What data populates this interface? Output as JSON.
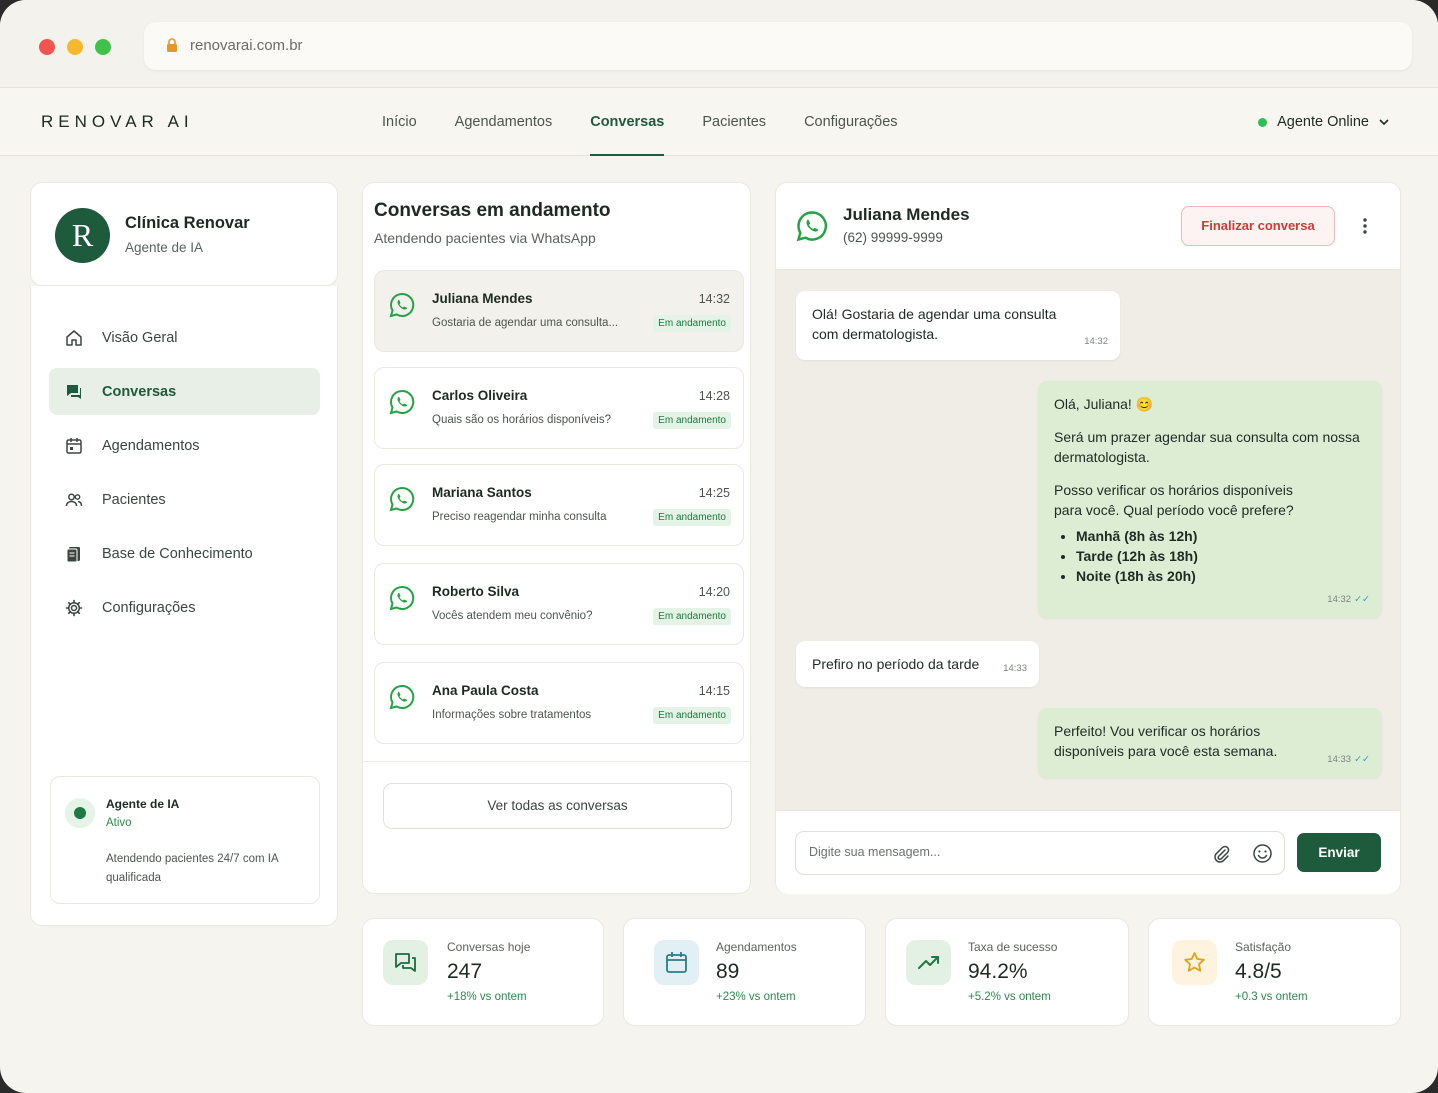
{
  "browser": {
    "url": "renovarai.com.br"
  },
  "header": {
    "logo": "RENOVAR AI",
    "nav": [
      "Início",
      "Agendamentos",
      "Conversas",
      "Pacientes",
      "Configurações"
    ],
    "active_nav": "Conversas",
    "agent_status": "Agente Online"
  },
  "sidebar": {
    "clinic_initial": "R",
    "clinic_name": "Clínica Renovar",
    "clinic_sub": "Agente de IA",
    "items": [
      {
        "label": "Visão Geral",
        "icon": "home-icon"
      },
      {
        "label": "Conversas",
        "icon": "chat-icon",
        "active": true
      },
      {
        "label": "Agendamentos",
        "icon": "calendar-icon"
      },
      {
        "label": "Pacientes",
        "icon": "users-icon"
      },
      {
        "label": "Base de Conhecimento",
        "icon": "book-icon"
      },
      {
        "label": "Configurações",
        "icon": "gear-icon"
      }
    ],
    "agent_box": {
      "title": "Agente de IA",
      "state": "Ativo",
      "desc": "Atendendo pacientes 24/7 com IA qualificada"
    }
  },
  "conversations": {
    "title": "Conversas em andamento",
    "subtitle": "Atendendo pacientes via WhatsApp",
    "items": [
      {
        "name": "Juliana Mendes",
        "time": "14:32",
        "preview": "Gostaria de agendar uma consulta...",
        "badge": "Em andamento"
      },
      {
        "name": "Carlos Oliveira",
        "time": "14:28",
        "preview": "Quais são os horários disponíveis?",
        "badge": "Em andamento"
      },
      {
        "name": "Mariana Santos",
        "time": "14:25",
        "preview": "Preciso reagendar minha consulta",
        "badge": "Em andamento"
      },
      {
        "name": "Roberto Silva",
        "time": "14:20",
        "preview": "Vocês atendem meu convênio?",
        "badge": "Em andamento"
      },
      {
        "name": "Ana Paula Costa",
        "time": "14:15",
        "preview": "Informações sobre tratamentos",
        "badge": "Em andamento"
      }
    ],
    "see_all": "Ver todas as conversas"
  },
  "chat": {
    "contact_name": "Juliana Mendes",
    "contact_phone": "(62) 99999-9999",
    "finish_label": "Finalizar conversa",
    "messages": {
      "m1": {
        "text": "Olá! Gostaria de agendar uma consulta com dermatologista.",
        "time": "14:32"
      },
      "m2": {
        "greeting": "Olá, Juliana! 😊",
        "p1": "Será um prazer agendar sua consulta com nossa dermatologista.",
        "p2": "Posso verificar os horários disponíveis para você. Qual período você prefere?",
        "options": [
          "Manhã (8h às 12h)",
          "Tarde (12h às 18h)",
          "Noite (18h às 20h)"
        ],
        "time": "14:32"
      },
      "m3": {
        "text": "Prefiro no período da tarde",
        "time": "14:33"
      },
      "m4": {
        "text": "Perfeito! Vou verificar os horários disponíveis para você esta semana.",
        "time": "14:33"
      }
    },
    "input_placeholder": "Digite sua mensagem...",
    "send_label": "Enviar"
  },
  "stats": [
    {
      "label": "Conversas hoje",
      "value": "247",
      "delta": "+18% vs ontem",
      "icon": "chat-bubbles-icon",
      "bg": "#e3f1e4",
      "color": "#1e6b3d"
    },
    {
      "label": "Agendamentos",
      "value": "89",
      "delta": "+23% vs ontem",
      "icon": "calendar-icon",
      "bg": "#e2eff4",
      "color": "#2a7c8c"
    },
    {
      "label": "Taxa de sucesso",
      "value": "94.2%",
      "delta": "+5.2% vs ontem",
      "icon": "trend-up-icon",
      "bg": "#e3f1e4",
      "color": "#1e7a42"
    },
    {
      "label": "Satisfação",
      "value": "4.8/5",
      "delta": "+0.3 vs ontem",
      "icon": "star-icon",
      "bg": "#fdf3df",
      "color": "#e2a21a"
    }
  ],
  "colors": {
    "brand": "#1e5a3c",
    "accent_green": "#2a8a4a",
    "danger": "#d03a33",
    "online": "#2fbf57",
    "whatsapp": "#25a244"
  }
}
